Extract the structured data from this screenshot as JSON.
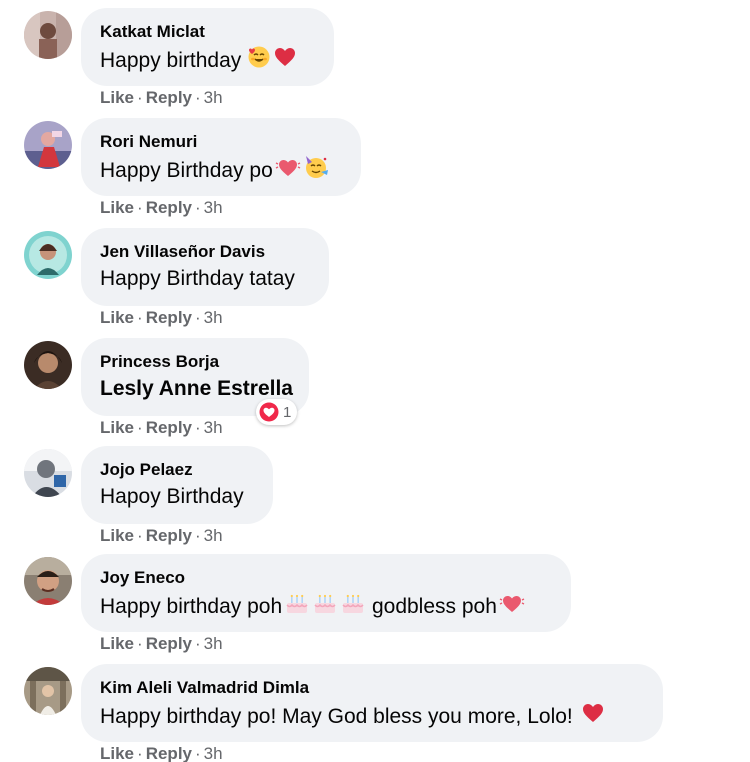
{
  "comments": [
    {
      "author": "Katkat Miclat",
      "text": "Happy birthday",
      "emojis": [
        "smiling-face-with-hearts",
        "red-heart"
      ],
      "actions": {
        "like": "Like",
        "reply": "Reply",
        "time": "3h"
      }
    },
    {
      "author": "Rori Nemuri",
      "text": "Happy Birthday po",
      "emojis": [
        "beating-heart",
        "partying-face"
      ],
      "actions": {
        "like": "Like",
        "reply": "Reply",
        "time": "3h"
      }
    },
    {
      "author": "Jen Villaseñor Davis",
      "text": "Happy Birthday tatay",
      "emojis": [],
      "actions": {
        "like": "Like",
        "reply": "Reply",
        "time": "3h"
      }
    },
    {
      "author": "Princess Borja",
      "text": "Lesly Anne Estrella",
      "tagged": true,
      "emojis": [],
      "reaction": {
        "icon": "love-reaction",
        "count": "1"
      },
      "actions": {
        "like": "Like",
        "reply": "Reply",
        "time": "3h"
      }
    },
    {
      "author": "Jojo Pelaez",
      "text": "Hapoy Birthday",
      "emojis": [],
      "actions": {
        "like": "Like",
        "reply": "Reply",
        "time": "3h"
      }
    },
    {
      "author": "Joy Eneco",
      "text": "Happy birthday poh",
      "text_after": " godbless poh",
      "emojis": [
        "birthday-cake",
        "birthday-cake",
        "birthday-cake"
      ],
      "emojis_after": [
        "beating-heart"
      ],
      "actions": {
        "like": "Like",
        "reply": "Reply",
        "time": "3h"
      }
    },
    {
      "author": "Kim Aleli Valmadrid Dimla",
      "text": "Happy birthday po! May God bless you more, Lolo!",
      "emojis": [
        "red-heart"
      ],
      "actions": {
        "like": "Like",
        "reply": "Reply",
        "time": "3h"
      }
    }
  ],
  "colors": {
    "bubble_bg": "#f0f2f5",
    "meta_text": "#65676b",
    "heart_red": "#f0284a"
  }
}
